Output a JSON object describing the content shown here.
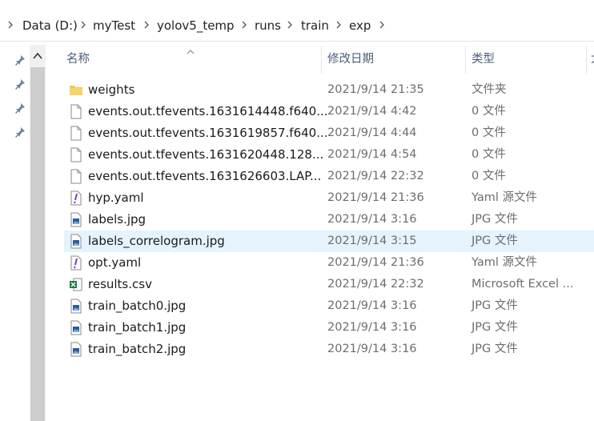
{
  "breadcrumb": [
    "Data (D:)",
    "myTest",
    "yolov5_temp",
    "runs",
    "train",
    "exp"
  ],
  "columns": {
    "name": "名称",
    "date": "修改日期",
    "type": "类型",
    "size": "大"
  },
  "files": [
    {
      "name": "weights",
      "date": "2021/9/14 21:35",
      "type": "文件夹",
      "icon": "folder-icon"
    },
    {
      "name": "events.out.tfevents.1631614448.f640...",
      "date": "2021/9/14 4:42",
      "type": "0 文件",
      "icon": "file-icon"
    },
    {
      "name": "events.out.tfevents.1631619857.f640...",
      "date": "2021/9/14 4:44",
      "type": "0 文件",
      "icon": "file-icon"
    },
    {
      "name": "events.out.tfevents.1631620448.128...",
      "date": "2021/9/14 4:54",
      "type": "0 文件",
      "icon": "file-icon"
    },
    {
      "name": "events.out.tfevents.1631626603.LAP...",
      "date": "2021/9/14 22:32",
      "type": "0 文件",
      "icon": "file-icon"
    },
    {
      "name": "hyp.yaml",
      "date": "2021/9/14 21:36",
      "type": "Yaml 源文件",
      "icon": "yaml-icon"
    },
    {
      "name": "labels.jpg",
      "date": "2021/9/14 3:16",
      "type": "JPG 文件",
      "icon": "image-icon"
    },
    {
      "name": "labels_correlogram.jpg",
      "date": "2021/9/14 3:15",
      "type": "JPG 文件",
      "icon": "image-icon",
      "selected": true
    },
    {
      "name": "opt.yaml",
      "date": "2021/9/14 21:36",
      "type": "Yaml 源文件",
      "icon": "yaml-icon"
    },
    {
      "name": "results.csv",
      "date": "2021/9/14 22:32",
      "type": "Microsoft Excel ...",
      "icon": "excel-icon"
    },
    {
      "name": "train_batch0.jpg",
      "date": "2021/9/14 3:16",
      "type": "JPG 文件",
      "icon": "image-icon"
    },
    {
      "name": "train_batch1.jpg",
      "date": "2021/9/14 3:16",
      "type": "JPG 文件",
      "icon": "image-icon"
    },
    {
      "name": "train_batch2.jpg",
      "date": "2021/9/14 3:16",
      "type": "JPG 文件",
      "icon": "image-icon"
    }
  ],
  "colors": {
    "selection": "#e5f3ff",
    "folder": "#f4c64b",
    "excel": "#1d7a43",
    "yaml": "#7a3fb7",
    "image": "#2a5c9a"
  }
}
